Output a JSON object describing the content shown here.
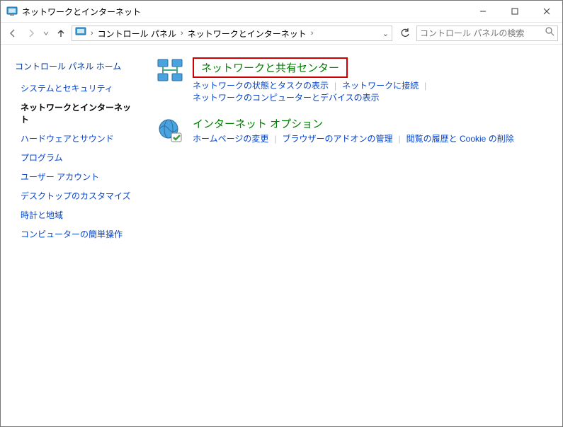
{
  "window": {
    "title": "ネットワークとインターネット"
  },
  "breadcrumb": {
    "root": "コントロール パネル",
    "current": "ネットワークとインターネット"
  },
  "search": {
    "placeholder": "コントロール パネルの検索"
  },
  "sidebar": {
    "home": "コントロール パネル ホーム",
    "items": [
      {
        "label": "システムとセキュリティ",
        "active": false
      },
      {
        "label": "ネットワークとインターネット",
        "active": true
      },
      {
        "label": "ハードウェアとサウンド",
        "active": false
      },
      {
        "label": "プログラム",
        "active": false
      },
      {
        "label": "ユーザー アカウント",
        "active": false
      },
      {
        "label": "デスクトップのカスタマイズ",
        "active": false
      },
      {
        "label": "時計と地域",
        "active": false
      },
      {
        "label": "コンピューターの簡単操作",
        "active": false
      }
    ]
  },
  "categories": [
    {
      "icon": "network",
      "heading": "ネットワークと共有センター",
      "highlighted": true,
      "links": [
        "ネットワークの状態とタスクの表示",
        "ネットワークに接続",
        "ネットワークのコンピューターとデバイスの表示"
      ]
    },
    {
      "icon": "internet",
      "heading": "インターネット オプション",
      "highlighted": false,
      "links": [
        "ホームページの変更",
        "ブラウザーのアドオンの管理",
        "閲覧の履歴と Cookie の削除"
      ]
    }
  ]
}
